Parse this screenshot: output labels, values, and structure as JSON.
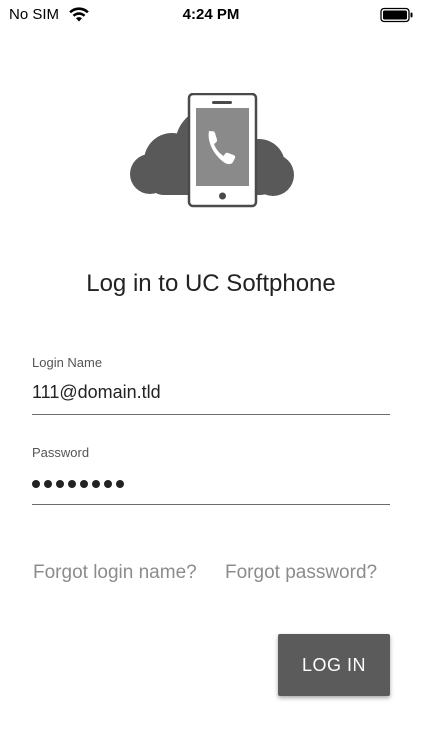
{
  "status_bar": {
    "carrier": "No SIM",
    "time": "4:24 PM",
    "wifi_icon": "wifi-icon",
    "battery_icon": "battery-full-icon"
  },
  "logo": {
    "icon": "cloud-phone-logo",
    "colors": {
      "cloud": "#595959",
      "phone_body": "#8a8a8a",
      "phone_frame": "#ffffff"
    }
  },
  "title": "Log in to UC Softphone",
  "login_name": {
    "label": "Login Name",
    "value": "111@domain.tld"
  },
  "password": {
    "label": "Password",
    "masked_length": 8
  },
  "links": {
    "forgot_login": "Forgot login name?",
    "forgot_password": "Forgot password?"
  },
  "login_button": {
    "label": "LOG IN",
    "color": "#5b5b5b"
  }
}
